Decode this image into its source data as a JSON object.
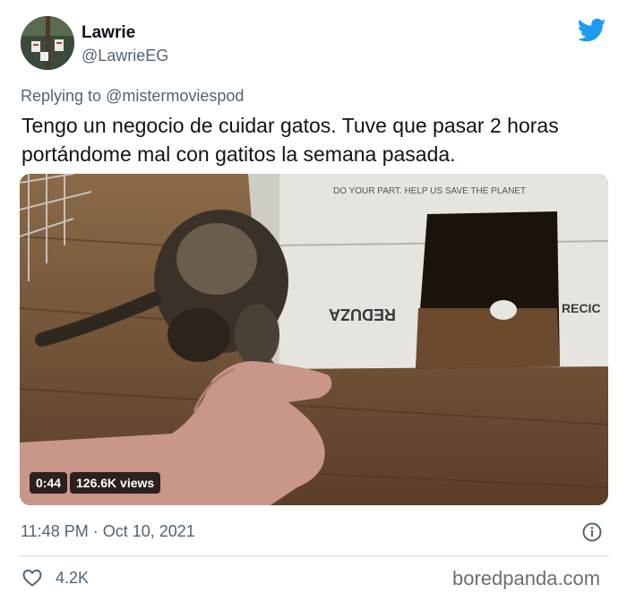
{
  "author": {
    "name": "Lawrie",
    "handle": "@LawrieEG"
  },
  "reply": {
    "prefix": "Replying to",
    "to_handle": "@mistermoviespod"
  },
  "tweet": {
    "text": "Tengo un negocio de cuidar gatos. Tuve que pasar 2 horas portándome mal con gatitos la semana pasada."
  },
  "media": {
    "duration": "0:44",
    "views": "126.6K views",
    "box_text": "DO YOUR PART. HELP US SAVE THE PLANET",
    "box_brand": "REDUZA",
    "box_brand_2": "RECIC"
  },
  "footer": {
    "timestamp": "11:48 PM · Oct 10, 2021",
    "likes": "4.2K",
    "watermark": "boredpanda.com"
  },
  "icons": {
    "bird": "twitter-bird-icon",
    "info": "info-icon",
    "heart": "heart-icon"
  },
  "colors": {
    "brand_blue": "#1d9bf0",
    "text_primary": "#0f1419",
    "text_secondary": "#536471"
  }
}
